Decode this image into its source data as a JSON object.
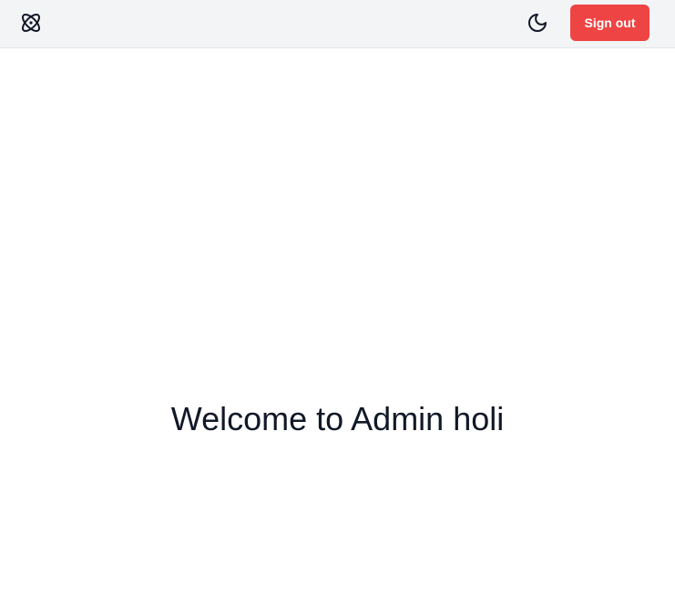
{
  "header": {
    "logo_icon": "atom-icon",
    "theme_toggle_icon": "moon-icon",
    "sign_out_label": "Sign out"
  },
  "main": {
    "welcome_text": "Welcome to Admin holi"
  },
  "colors": {
    "header_bg": "#f3f4f6",
    "sign_out_bg": "#ef4444",
    "text": "#111827",
    "page_bg": "#ffffff"
  }
}
